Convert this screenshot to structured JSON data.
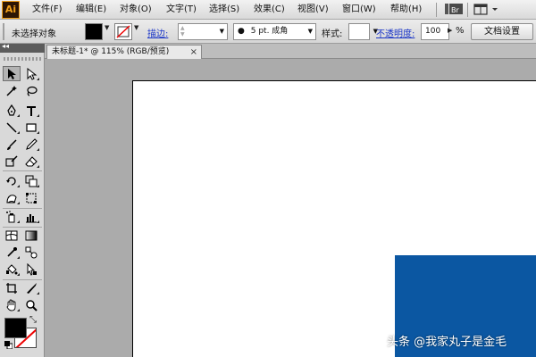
{
  "app": {
    "logo": "Ai"
  },
  "menu": {
    "items": [
      "文件(F)",
      "编辑(E)",
      "对象(O)",
      "文字(T)",
      "选择(S)",
      "效果(C)",
      "视图(V)",
      "窗口(W)",
      "帮助(H)"
    ],
    "bridge_label": "Br"
  },
  "control_bar": {
    "selection_status": "未选择对象",
    "fill_color": "#000000",
    "stroke_link": "描边:",
    "stroke_weight": "",
    "brush_label": "5 pt. 成角",
    "style_label": "样式:",
    "opacity_link": "不透明度:",
    "opacity_value": "100",
    "opacity_unit": "%",
    "doc_settings_button": "文档设置"
  },
  "document": {
    "tab_title": "未标题-1* @ 115% (RGB/预览)",
    "close_symbol": "×",
    "shape_color": "#0b57a2"
  },
  "tools": {
    "fill_color": "#000000",
    "stroke_color": "#ffffff"
  },
  "watermark": "头条 @我家丸子是金毛"
}
